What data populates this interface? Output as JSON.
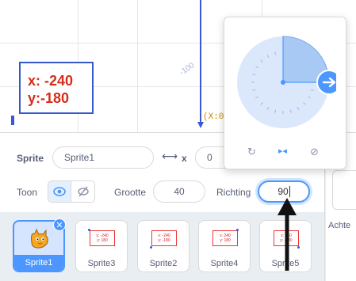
{
  "stage": {
    "coord_x": "x: -240",
    "coord_y": "y:-180",
    "ruler_label": "-100",
    "origin_label": "(X:0"
  },
  "sprite_info": {
    "sprite_label": "Sprite",
    "sprite_name": "Sprite1",
    "x_label": "x",
    "x_value": "0",
    "costume_label": "Toon",
    "size_label": "Grootte",
    "size_value": "40",
    "direction_label": "Richting",
    "direction_value": "90"
  },
  "direction_dial": {
    "direction": 90,
    "mode_icons": [
      "rotate-all-around-icon",
      "left-right-icon",
      "dont-rotate-icon"
    ]
  },
  "sprites": [
    {
      "name": "Sprite1",
      "selected": true
    },
    {
      "name": "Sprite3",
      "thumb_x": "x: -240",
      "thumb_y": "y: 180"
    },
    {
      "name": "Sprite2",
      "thumb_x": "x: -240",
      "thumb_y": "y: -180"
    },
    {
      "name": "Sprite4",
      "thumb_x": "x: 240",
      "thumb_y": "y: 180"
    },
    {
      "name": "Sprite5",
      "thumb_x": "x: 240",
      "thumb_y": "y: -180"
    }
  ],
  "right_panel": {
    "label": "Achte"
  },
  "colors": {
    "accent": "#4c97ff",
    "coord_text": "#d42e1a",
    "axis": "#3a57d8"
  }
}
